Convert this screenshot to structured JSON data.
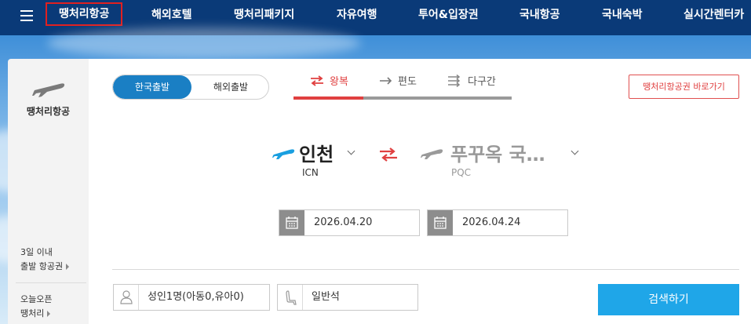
{
  "nav": {
    "items": [
      {
        "label": "땡처리항공",
        "active": true
      },
      {
        "label": "해외호텔"
      },
      {
        "label": "땡처리패키지"
      },
      {
        "label": "자유여행"
      },
      {
        "label": "투어&입장권"
      },
      {
        "label": "국내항공"
      },
      {
        "label": "국내숙박"
      },
      {
        "label": "실시간렌터카"
      }
    ]
  },
  "sidebar": {
    "brand": "땡처리항공",
    "promo1": [
      "3일 이내",
      "출발 항공권"
    ],
    "promo2": [
      "오늘오픈",
      "땡처리"
    ]
  },
  "search": {
    "departure_toggle": {
      "domestic": "한국출발",
      "overseas": "해외출발",
      "selected": "한국출발"
    },
    "trip_types": [
      "왕복",
      "편도",
      "다구간"
    ],
    "selected_trip": "왕복",
    "shortcut": "땡처리항공권 바로가기",
    "from": {
      "city": "인천",
      "code": "ICN"
    },
    "to": {
      "city": "푸꾸옥 국…",
      "code": "PQC"
    },
    "depart_date": "2026.04.20",
    "return_date": "2026.04.24",
    "passengers": "성인1명(아동0,유아0)",
    "cabin": "일반석",
    "search_button": "검색하기"
  },
  "colors": {
    "nav_bg": "#0a3a78",
    "accent_blue": "#1a7fc4",
    "accent_red": "#e04040",
    "search_button": "#1fa6e8"
  }
}
